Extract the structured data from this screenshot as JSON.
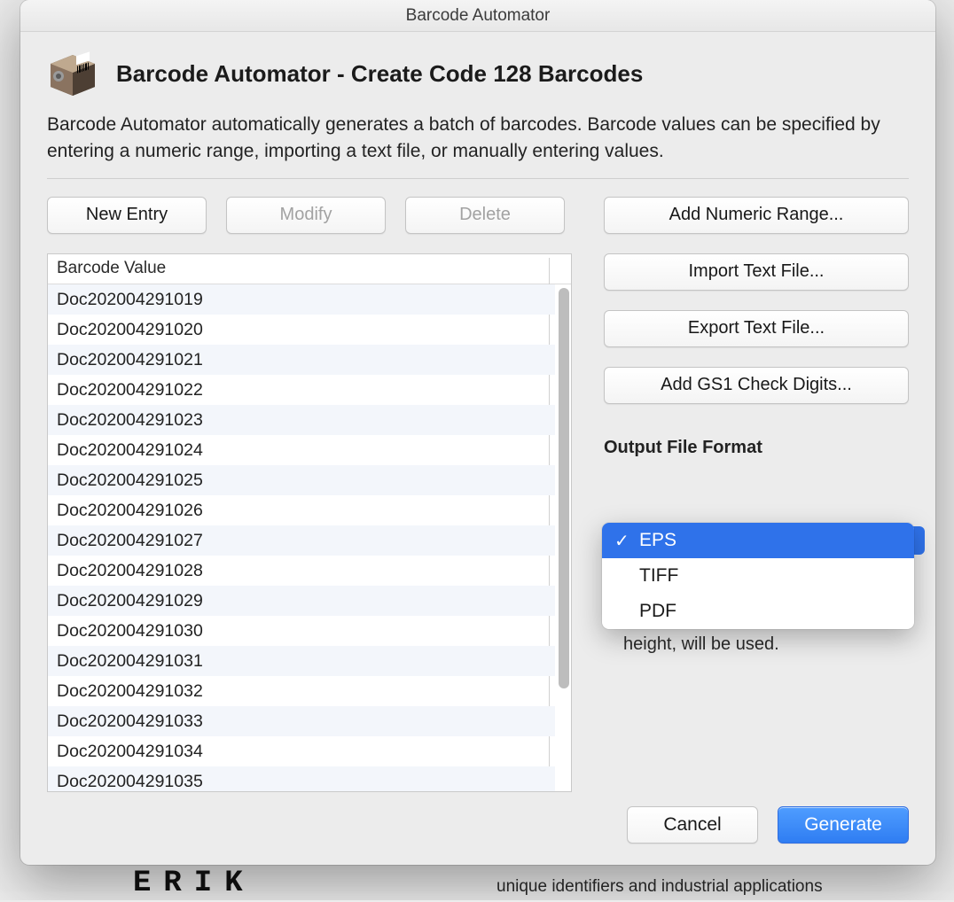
{
  "window": {
    "title": "Barcode Automator"
  },
  "header": {
    "page_title": "Barcode Automator - Create Code 128 Barcodes",
    "description": "Barcode Automator automatically generates a batch of barcodes. Barcode values can be specified by entering a numeric range, importing a text file, or manually entering values."
  },
  "toolbar": {
    "new_entry": "New Entry",
    "modify": "Modify",
    "delete": "Delete"
  },
  "side_buttons": {
    "add_numeric_range": "Add Numeric Range...",
    "import_text_file": "Import Text File...",
    "export_text_file": "Export Text File...",
    "add_gs1": "Add GS1 Check Digits..."
  },
  "table": {
    "header": "Barcode Value",
    "rows": [
      "Doc202004291019",
      "Doc202004291020",
      "Doc202004291021",
      "Doc202004291022",
      "Doc202004291023",
      "Doc202004291024",
      "Doc202004291025",
      "Doc202004291026",
      "Doc202004291027",
      "Doc202004291028",
      "Doc202004291029",
      "Doc202004291030",
      "Doc202004291031",
      "Doc202004291032",
      "Doc202004291033",
      "Doc202004291034",
      "Doc202004291035"
    ]
  },
  "output": {
    "section_label": "Output File Format",
    "options": [
      "EPS",
      "TIFF",
      "PDF"
    ],
    "selected": "EPS",
    "hint_tail": "height, will be used."
  },
  "footer": {
    "cancel": "Cancel",
    "generate": "Generate"
  },
  "background": {
    "fragment_right": "unique identifiers  and industrial applications",
    "fragment_left": "ERIK"
  }
}
